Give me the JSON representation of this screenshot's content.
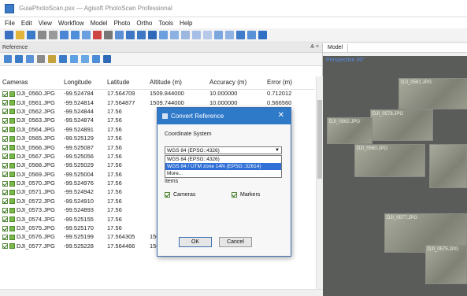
{
  "window": {
    "title": "GuiaPhotoScan.psx — Agisoft PhotoScan Professional"
  },
  "menu": [
    "File",
    "Edit",
    "View",
    "Workflow",
    "Model",
    "Photo",
    "Ortho",
    "Tools",
    "Help"
  ],
  "reference_pane": {
    "title": "Reference",
    "controls": "Ѧ ×",
    "columns": [
      "Cameras",
      "Longitude",
      "Latitude",
      "Altitude (m)",
      "Accuracy (m)",
      "Error (m)"
    ],
    "rows": [
      [
        "DJI_0560.JPG",
        "-99.524784",
        "17.564709",
        "1509.844000",
        "10.000000",
        "0.712012"
      ],
      [
        "DJI_0561.JPG",
        "-99.524814",
        "17.564877",
        "1509.744000",
        "10.000000",
        "0.566560"
      ],
      [
        "DJI_0562.JPG",
        "-99.524844",
        "17.56",
        "",
        "",
        ""
      ],
      [
        "DJI_0563.JPG",
        "-99.524874",
        "17.56",
        "",
        "",
        ""
      ],
      [
        "DJI_0564.JPG",
        "-99.524891",
        "17.56",
        "",
        "",
        ""
      ],
      [
        "DJI_0565.JPG",
        "-99.525129",
        "17.56",
        "",
        "",
        ""
      ],
      [
        "DJI_0566.JPG",
        "-99.525087",
        "17.56",
        "",
        "",
        ""
      ],
      [
        "DJI_0567.JPG",
        "-99.525056",
        "17.56",
        "",
        "",
        ""
      ],
      [
        "DJI_0568.JPG",
        "-99.525029",
        "17.56",
        "",
        "",
        ""
      ],
      [
        "DJI_0569.JPG",
        "-99.525004",
        "17.56",
        "",
        "",
        ""
      ],
      [
        "DJI_0570.JPG",
        "-99.524976",
        "17.56",
        "",
        "",
        ""
      ],
      [
        "DJI_0571.JPG",
        "-99.524942",
        "17.56",
        "",
        "",
        ""
      ],
      [
        "DJI_0572.JPG",
        "-99.524910",
        "17.56",
        "",
        "",
        ""
      ],
      [
        "DJI_0573.JPG",
        "-99.524893",
        "17.56",
        "",
        "",
        ""
      ],
      [
        "DJI_0574.JPG",
        "-99.525155",
        "17.56",
        "",
        "",
        ""
      ],
      [
        "DJI_0575.JPG",
        "-99.525170",
        "17.56",
        "",
        "",
        ""
      ],
      [
        "DJI_0576.JPG",
        "-99.525199",
        "17.564305",
        "1509.744000",
        "10.000000",
        "0.784212"
      ],
      [
        "DJI_0577.JPG",
        "-99.525228",
        "17.564466",
        "1509.644000",
        "10.000000",
        "0.593655"
      ]
    ]
  },
  "model_pane": {
    "tab": "Model",
    "viewport_label": "Perspective 30°",
    "photo_labels": [
      "DJI_0561.JPG",
      "DJI_0578.JPG",
      "DJI_0562.JPG",
      "DJI_0580.JPG",
      "DJI_0577.JPG",
      "DJI_0575.JPG"
    ]
  },
  "dialog": {
    "title": "Convert Reference",
    "coord_system_label": "Coordinate System",
    "selected": "WGS 84 (EPSG::4326)",
    "options": [
      "WGS 84 (EPSG::4326)",
      "WGS 84 / UTM zone 14N (EPSG::32614)",
      "More..."
    ],
    "items_label": "Items",
    "cameras_label": "Cameras",
    "markers_label": "Markers",
    "ok_label": "OK",
    "cancel_label": "Cancel"
  }
}
